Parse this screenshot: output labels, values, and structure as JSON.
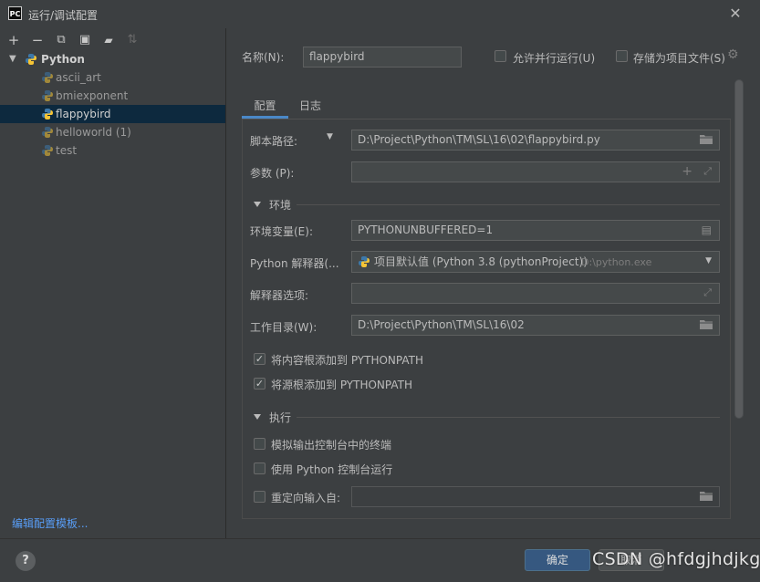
{
  "window": {
    "app_icon_text": "PC",
    "title": "运行/调试配置",
    "close_glyph": "✕"
  },
  "left_toolbar": [
    {
      "name": "add-icon",
      "glyph": "+"
    },
    {
      "name": "remove-icon",
      "glyph": "−"
    },
    {
      "name": "copy-icon",
      "glyph": "⧉"
    },
    {
      "name": "save-icon",
      "glyph": "▣"
    },
    {
      "name": "new-folder-icon",
      "glyph": "▰"
    },
    {
      "name": "sort-icon",
      "glyph": "⇅"
    }
  ],
  "tree": {
    "root": "Python",
    "items": [
      "ascii_art",
      "bmiexponent",
      "flappybird",
      "helloworld (1)",
      "test"
    ],
    "selected": "flappybird"
  },
  "edit_templates_link": "编辑配置模板...",
  "name_row": {
    "label": "名称(N):",
    "value": "flappybird",
    "allow_parallel": "允许并行运行(U)",
    "store_as_file": "存储为项目文件(S)"
  },
  "tabs": [
    {
      "label": "配置",
      "active": true
    },
    {
      "label": "日志",
      "active": false
    }
  ],
  "config": {
    "script_path_label": "脚本路径:",
    "script_path_value": "D:\\Project\\Python\\TM\\SL\\16\\02\\flappybird.py",
    "params_label": "参数 (P):",
    "params_value": "",
    "env_section": "环境",
    "env_vars_label": "环境变量(E):",
    "env_vars_value": "PYTHONUNBUFFERED=1",
    "interpreter_label": "Python 解释器(...",
    "interpreter_value": "项目默认值 (Python 3.8 (pythonProject))",
    "interpreter_path": "D:\\python.exe",
    "interp_options_label": "解释器选项:",
    "interp_options_value": "",
    "workdir_label": "工作目录(W):",
    "workdir_value": "D:\\Project\\Python\\TM\\SL\\16\\02",
    "add_content_roots": "将内容根添加到 PYTHONPATH",
    "add_source_roots": "将源根添加到 PYTHONPATH",
    "exec_section": "执行",
    "emulate_terminal": "模拟输出控制台中的终端",
    "run_with_console": "使用 Python 控制台运行",
    "redirect_input": "重定向输入自:",
    "redirect_value": ""
  },
  "checkbox_states": {
    "allow_parallel": false,
    "store_as_file": false,
    "add_content_roots": true,
    "add_source_roots": true,
    "emulate_terminal": false,
    "run_with_console": false,
    "redirect_input": false
  },
  "buttons": {
    "help": "?",
    "ok": "确定",
    "cancel": "取消"
  },
  "watermark": "CSDN @hfdgjhdjkg",
  "colors": {
    "background": "#3c3f41",
    "field_bg": "#45494a",
    "selection": "#0d293e",
    "accent": "#4a88c7",
    "link": "#589df6",
    "ok_button": "#365880"
  }
}
